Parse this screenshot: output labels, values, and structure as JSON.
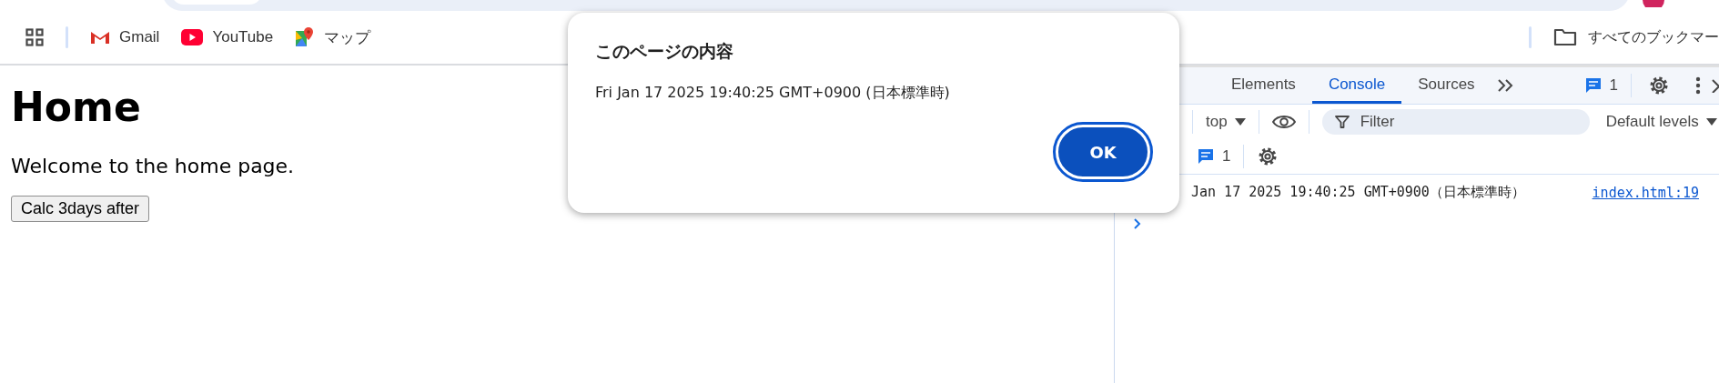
{
  "bookmarks_bar": {
    "items": [
      {
        "label": "Gmail",
        "kind": "gmail"
      },
      {
        "label": "YouTube",
        "kind": "youtube"
      },
      {
        "label": "マップ",
        "kind": "maps"
      }
    ],
    "all_bookmarks": "すべてのブックマー"
  },
  "page": {
    "heading": "Home",
    "text": "Welcome to the home page.",
    "button": "Calc 3days after"
  },
  "devtools": {
    "tabs": [
      {
        "label": "Elements",
        "selected": false
      },
      {
        "label": "Console",
        "selected": true
      },
      {
        "label": "Sources",
        "selected": false
      }
    ],
    "issues_count": "1",
    "context": "top",
    "filter_placeholder": "Filter",
    "levels": "Default levels",
    "messages_count": "1",
    "messages": [
      {
        "text": "Jan 17 2025 19:40:25 GMT+0900（日本標準時）",
        "source": "index.html:19"
      }
    ]
  },
  "dialog": {
    "title": "このページの内容",
    "message": "Fri Jan 17 2025 19:40:25 GMT+0900 (日本標準時)",
    "ok": "OK"
  }
}
